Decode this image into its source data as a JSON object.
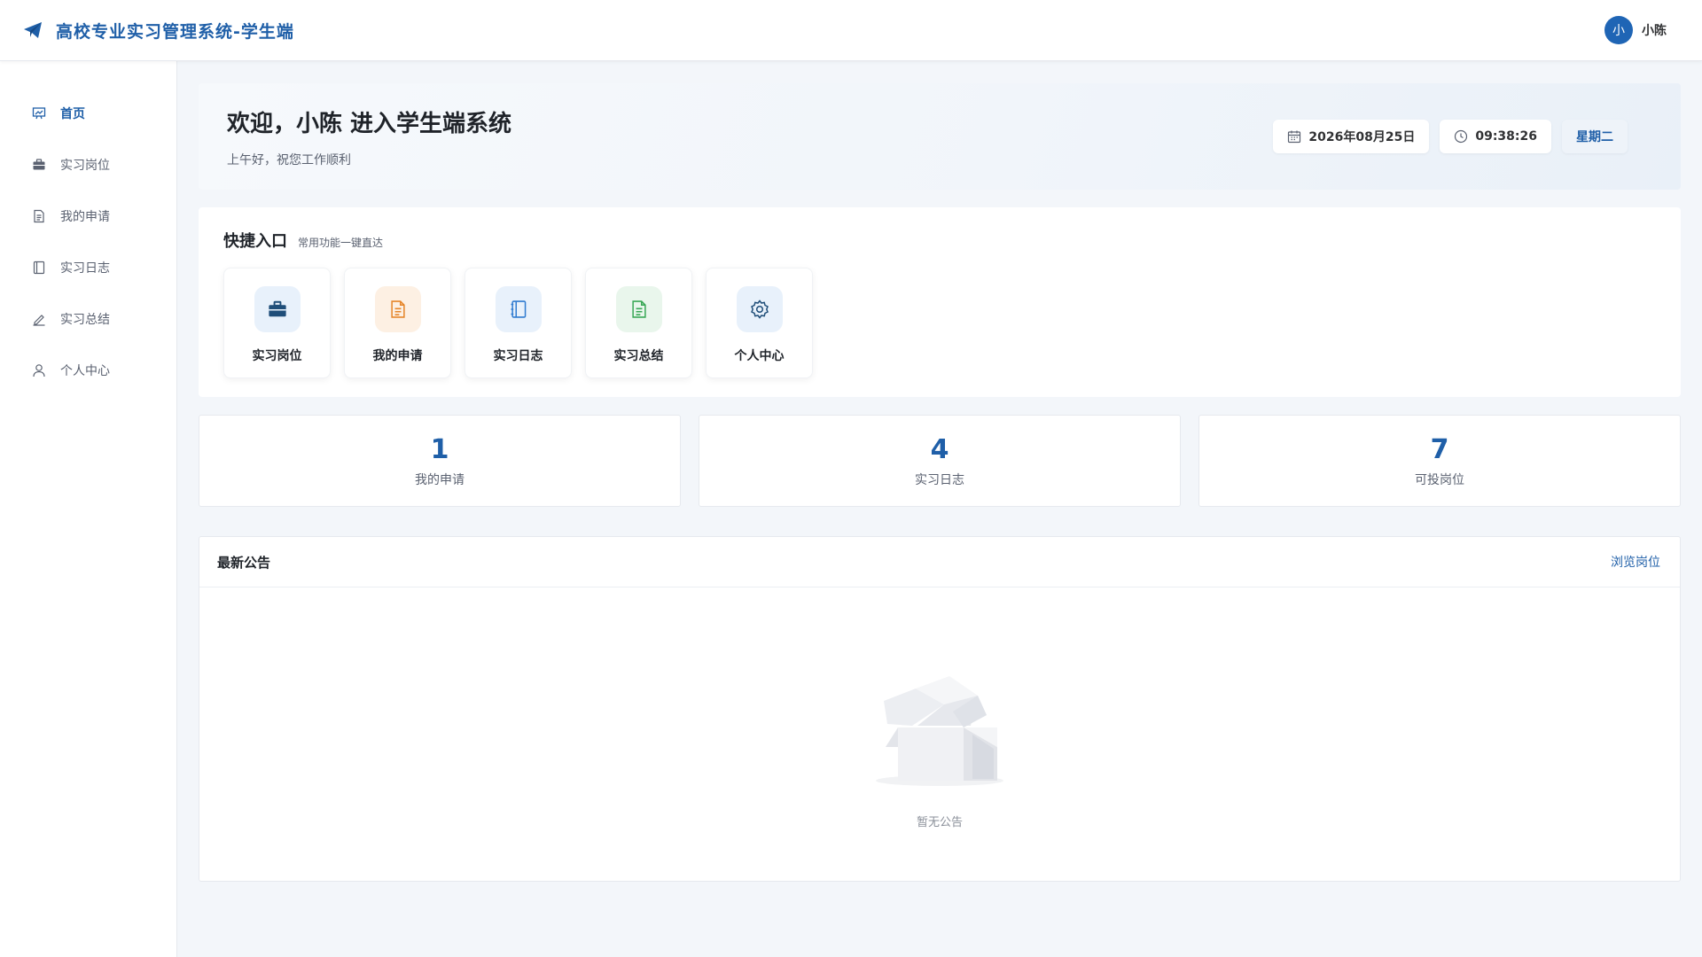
{
  "app": {
    "title": "高校专业实习管理系统-学生端"
  },
  "user": {
    "avatar_char": "小",
    "name": "小陈"
  },
  "sidebar": {
    "items": [
      {
        "label": "首页",
        "icon": "dashboard-icon",
        "active": true
      },
      {
        "label": "实习岗位",
        "icon": "briefcase-icon",
        "active": false
      },
      {
        "label": "我的申请",
        "icon": "document-icon",
        "active": false
      },
      {
        "label": "实习日志",
        "icon": "notebook-icon",
        "active": false
      },
      {
        "label": "实习总结",
        "icon": "edit-pen-icon",
        "active": false
      },
      {
        "label": "个人中心",
        "icon": "user-icon",
        "active": false
      }
    ]
  },
  "welcome": {
    "title": "欢迎，小陈 进入学生端系统",
    "subtitle": "上午好，祝您工作顺利",
    "date": "2026年08月25日",
    "time": "09:38:26",
    "weekday": "星期二"
  },
  "quick": {
    "title": "快捷入口",
    "subtitle": "常用功能一键直达",
    "items": [
      {
        "label": "实习岗位",
        "icon": "briefcase-icon",
        "color": "#1f4e79",
        "bg": "#e8f1fb"
      },
      {
        "label": "我的申请",
        "icon": "document-icon",
        "color": "#e6862b",
        "bg": "#fdf0e3"
      },
      {
        "label": "实习日志",
        "icon": "notebook-icon",
        "color": "#2f7bd0",
        "bg": "#e8f1fb"
      },
      {
        "label": "实习总结",
        "icon": "document-icon",
        "color": "#3aa857",
        "bg": "#e9f6ec"
      },
      {
        "label": "个人中心",
        "icon": "gear-icon",
        "color": "#1f4e79",
        "bg": "#e8f1fb"
      }
    ]
  },
  "stats": [
    {
      "value": "1",
      "label": "我的申请"
    },
    {
      "value": "4",
      "label": "实习日志"
    },
    {
      "value": "7",
      "label": "可投岗位"
    }
  ],
  "notice": {
    "title": "最新公告",
    "link": "浏览岗位",
    "empty_text": "暂无公告"
  },
  "colors": {
    "primary": "#1f5fa8",
    "background": "#f3f6fa"
  }
}
